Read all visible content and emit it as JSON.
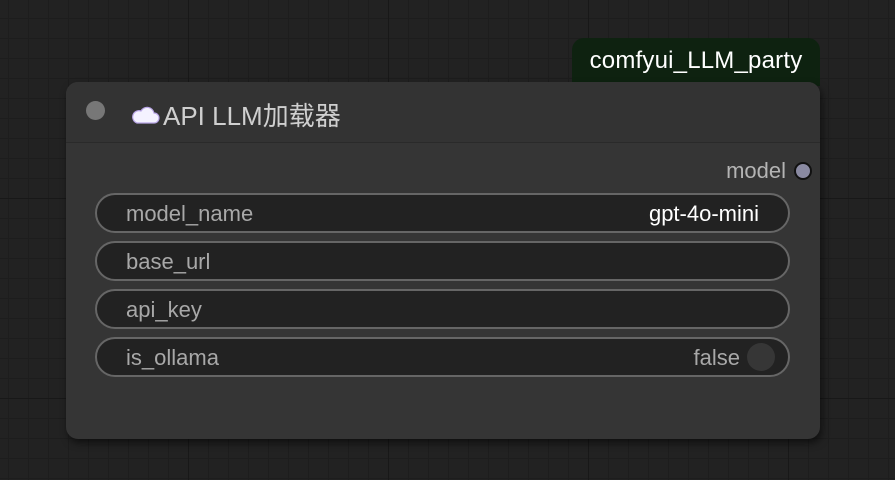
{
  "badge": {
    "label": "comfyui_LLM_party"
  },
  "node": {
    "title": "API LLM加载器",
    "title_icon": "cloud-icon",
    "output": {
      "label": "model"
    },
    "widgets": [
      {
        "label": "model_name",
        "value": "gpt-4o-mini"
      },
      {
        "label": "base_url",
        "value": ""
      },
      {
        "label": "api_key",
        "value": ""
      },
      {
        "label": "is_ollama",
        "value": "false",
        "type": "toggle"
      }
    ]
  },
  "colors": {
    "canvas": "#222222",
    "node_body": "#353535",
    "badge_bg": "#0e2210",
    "widget_bg": "#222222",
    "widget_border": "#666666",
    "output_slot": "#8a8aa2"
  }
}
